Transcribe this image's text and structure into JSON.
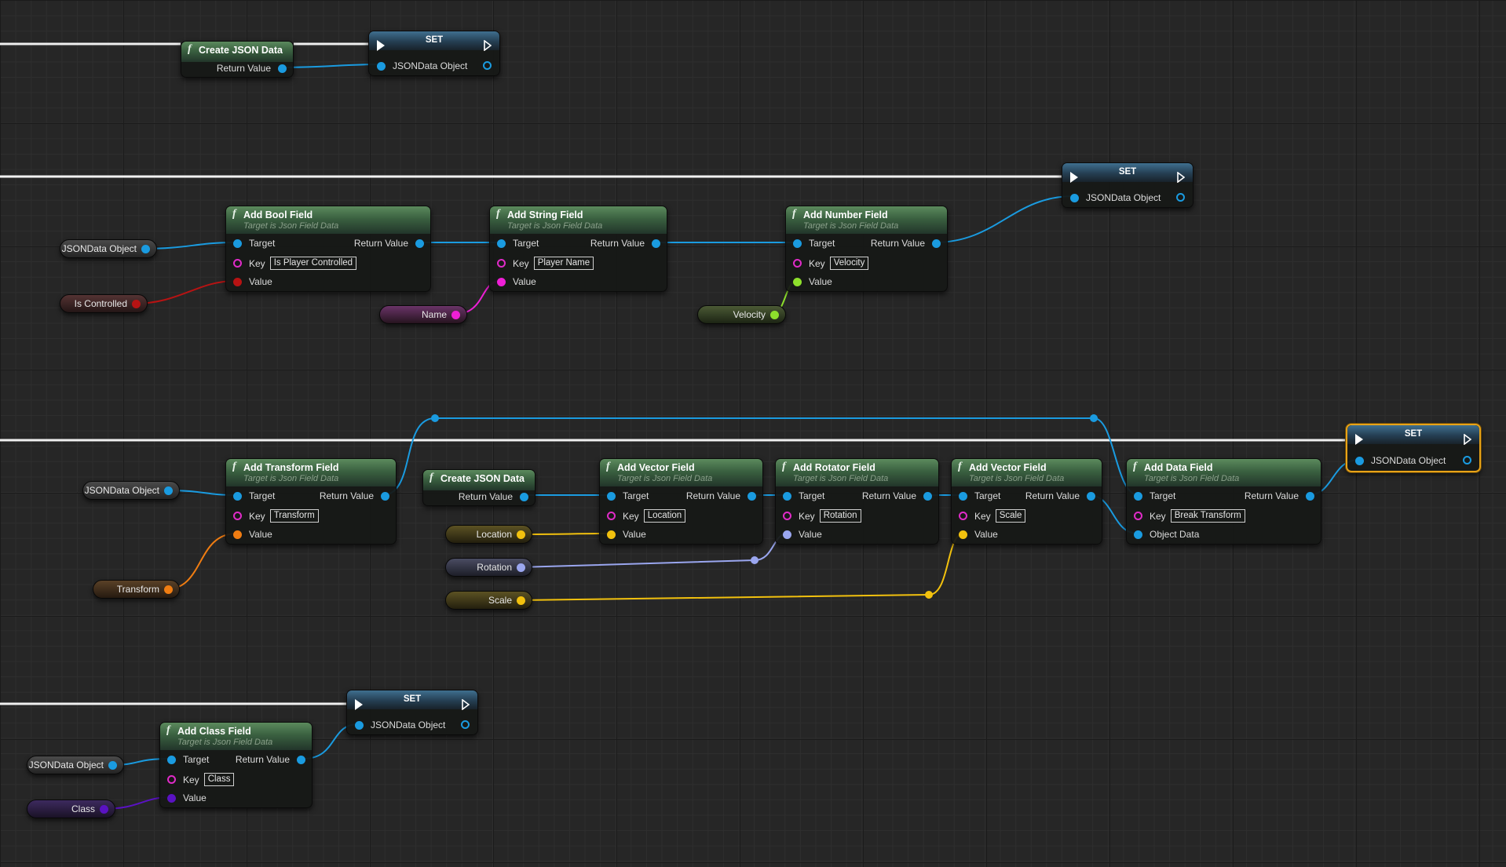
{
  "colors": {
    "object": "#1a9be0",
    "bool": "#b71313",
    "string": "#ee1fd6",
    "number": "#8ee02c",
    "transform": "#f07d12",
    "vector": "#f2c10e",
    "rotator": "#9aa6ef",
    "class": "#5a12c2",
    "key_ring": "#e02bc8",
    "exec": "#ffffff"
  },
  "labels": {
    "create_json_data": "Create JSON Data",
    "set": "SET",
    "return_value": "Return Value",
    "target": "Target",
    "key": "Key",
    "value": "Value",
    "object_data": "Object Data",
    "jsondata_object": "JSONData Object",
    "subtitle": "Target is Json Field Data"
  },
  "nodes": {
    "add_bool": {
      "title": "Add Bool Field",
      "key": "Is Player Controlled"
    },
    "add_string": {
      "title": "Add String Field",
      "key": "Player Name"
    },
    "add_number": {
      "title": "Add Number Field",
      "key": "Velocity"
    },
    "add_transform": {
      "title": "Add Transform Field",
      "key": "Transform"
    },
    "add_vector_location": {
      "title": "Add Vector Field",
      "key": "Location"
    },
    "add_rotator": {
      "title": "Add Rotator Field",
      "key": "Rotation"
    },
    "add_vector_scale": {
      "title": "Add Vector Field",
      "key": "Scale"
    },
    "add_data": {
      "title": "Add Data Field",
      "key": "Break Transform"
    },
    "add_class": {
      "title": "Add Class Field",
      "key": "Class"
    }
  },
  "variables": {
    "jsondata_object": "JSONData Object",
    "is_controlled": "Is Controlled",
    "name": "Name",
    "velocity": "Velocity",
    "transform": "Transform",
    "location": "Location",
    "rotation": "Rotation",
    "scale": "Scale",
    "class": "Class"
  }
}
